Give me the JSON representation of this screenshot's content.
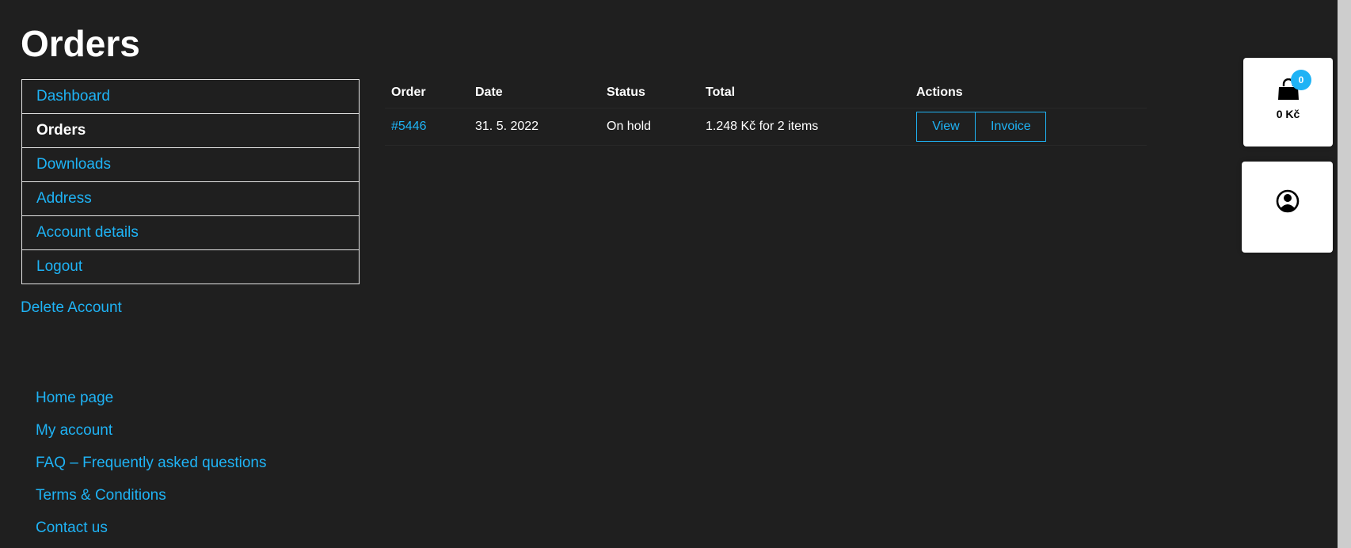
{
  "page": {
    "title": "Orders"
  },
  "account_nav": {
    "items": [
      {
        "label": "Dashboard",
        "active": false
      },
      {
        "label": "Orders",
        "active": true
      },
      {
        "label": "Downloads",
        "active": false
      },
      {
        "label": "Address",
        "active": false
      },
      {
        "label": "Account details",
        "active": false
      },
      {
        "label": "Logout",
        "active": false
      }
    ],
    "delete_account": "Delete Account"
  },
  "orders_table": {
    "headers": {
      "order": "Order",
      "date": "Date",
      "status": "Status",
      "total": "Total",
      "actions": "Actions"
    },
    "rows": [
      {
        "order": "#5446",
        "date": "31. 5. 2022",
        "status": "On hold",
        "total": "1.248 Kč for 2 items",
        "view_label": "View",
        "invoice_label": "Invoice"
      }
    ]
  },
  "footer_links": [
    "Home page",
    "My account",
    "FAQ – Frequently asked questions",
    "Terms & Conditions",
    "Contact us"
  ],
  "cart_widget": {
    "icon": "shopping-bag-icon",
    "count": "0",
    "total": "0 Kč"
  },
  "account_widget": {
    "icon": "user-circle-icon"
  },
  "colors": {
    "background": "#1f1f1f",
    "accent": "#1fb3f5",
    "text": "#ffffff"
  }
}
